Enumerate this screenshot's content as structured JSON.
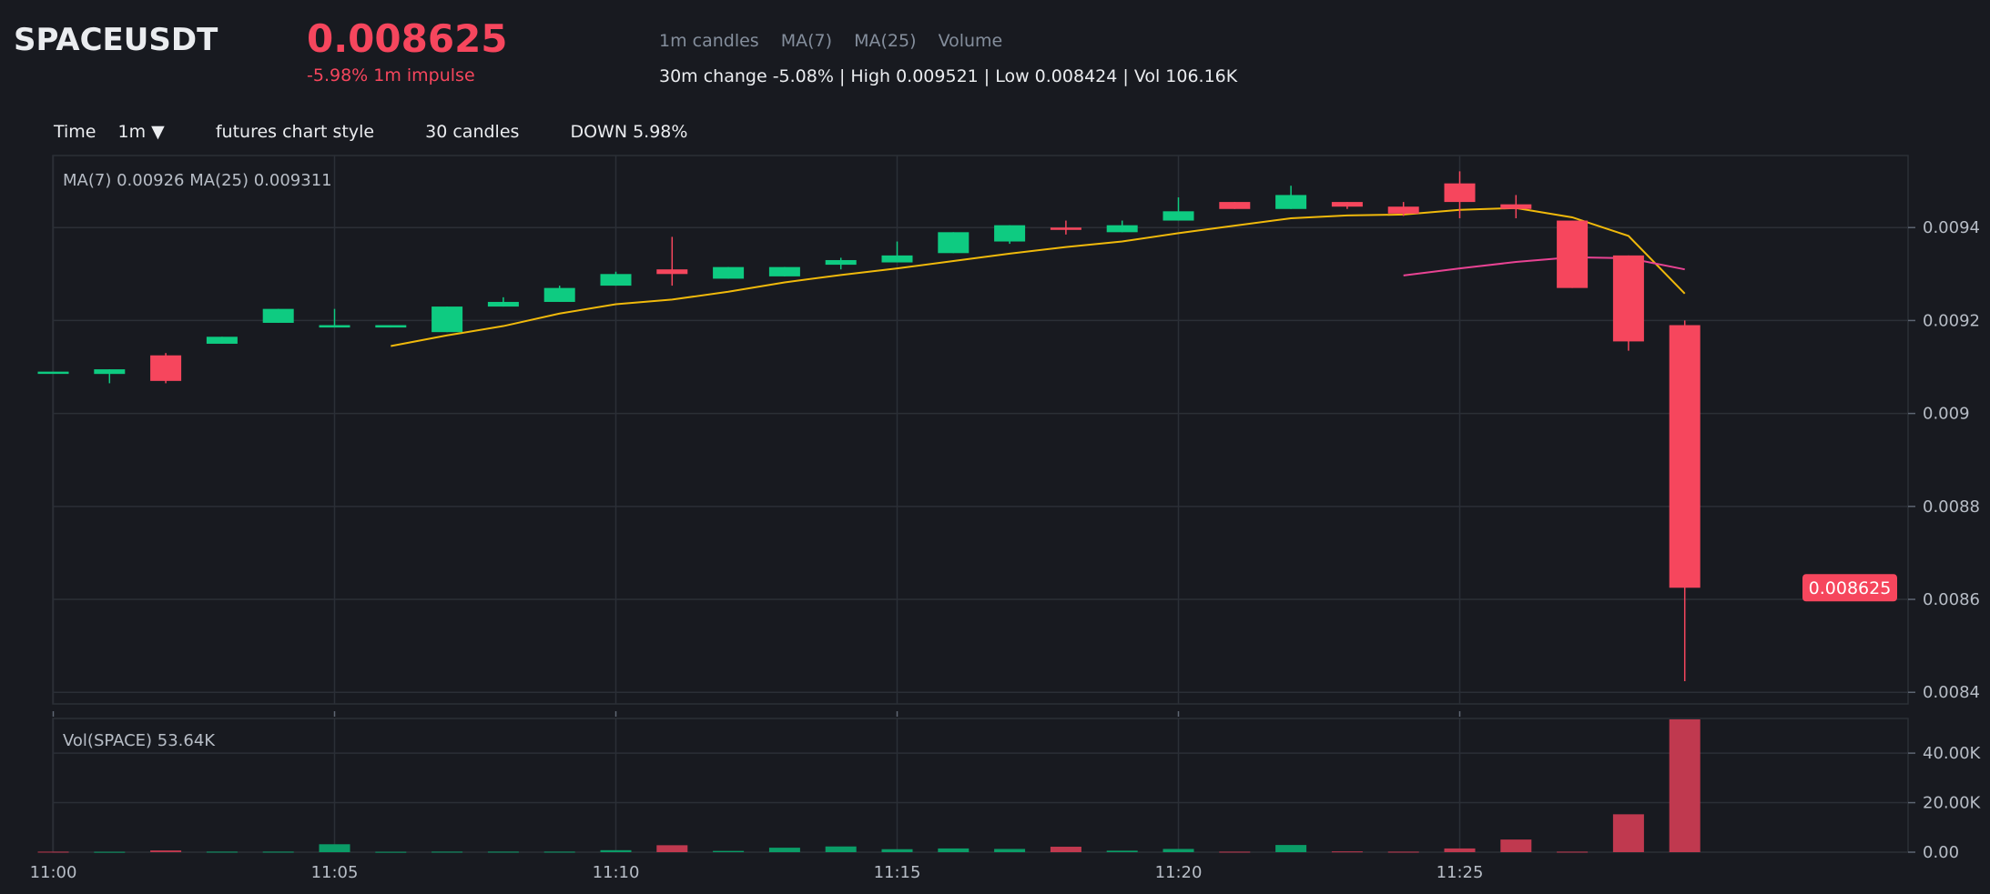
{
  "header": {
    "symbol": "SPACEUSDT",
    "price": "0.008625",
    "impulse": "-5.98% 1m impulse",
    "indicators": [
      "1m candles",
      "MA(7)",
      "MA(25)",
      "Volume"
    ],
    "stats": "30m change -5.08% | High 0.009521 | Low 0.008424 | Vol 106.16K"
  },
  "toolbar": {
    "time_label": "Time",
    "interval": "1m ▼",
    "style": "futures chart style",
    "candles": "30 candles",
    "direction": "DOWN 5.98%"
  },
  "colors": {
    "background": "#181a20",
    "up": "#0ecb81",
    "down": "#f6465d",
    "ma7": "#f0b90b",
    "ma25": "#e84393",
    "volume_down": "#c0394f",
    "volume_up": "#0b9c67",
    "grid": "#2b2f36"
  },
  "chart_data": [
    {
      "type": "candlestick",
      "legend": "MA(7) 0.00926    MA(25) 0.009311",
      "last_price_label": "0.008625",
      "y_ticks": [
        "0.0094",
        "0.0092",
        "0.009",
        "0.0088",
        "0.0086",
        "0.0084"
      ],
      "ylim": [
        0.008375,
        0.009555
      ],
      "x_ticks": [
        "11:00",
        "11:05",
        "11:10",
        "11:15",
        "11:20",
        "11:25"
      ],
      "times": [
        "11:00",
        "11:01",
        "11:02",
        "11:03",
        "11:04",
        "11:05",
        "11:06",
        "11:07",
        "11:08",
        "11:09",
        "11:10",
        "11:11",
        "11:12",
        "11:13",
        "11:14",
        "11:15",
        "11:16",
        "11:17",
        "11:18",
        "11:19",
        "11:20",
        "11:21",
        "11:22",
        "11:23",
        "11:24",
        "11:25",
        "11:26",
        "11:27",
        "11:28",
        "11:29"
      ],
      "candles": [
        {
          "o": 0.00909,
          "h": 0.00909,
          "l": 0.00909,
          "c": 0.00909
        },
        {
          "o": 0.009085,
          "h": 0.009095,
          "l": 0.009065,
          "c": 0.009095
        },
        {
          "o": 0.009125,
          "h": 0.00913,
          "l": 0.009065,
          "c": 0.00907
        },
        {
          "o": 0.00915,
          "h": 0.009165,
          "l": 0.00915,
          "c": 0.009165
        },
        {
          "o": 0.009195,
          "h": 0.009225,
          "l": 0.009195,
          "c": 0.009225
        },
        {
          "o": 0.009185,
          "h": 0.009225,
          "l": 0.009185,
          "c": 0.00919
        },
        {
          "o": 0.009185,
          "h": 0.00919,
          "l": 0.009185,
          "c": 0.00919
        },
        {
          "o": 0.009175,
          "h": 0.00923,
          "l": 0.009175,
          "c": 0.00923
        },
        {
          "o": 0.00923,
          "h": 0.00925,
          "l": 0.00923,
          "c": 0.00924
        },
        {
          "o": 0.00924,
          "h": 0.009275,
          "l": 0.00924,
          "c": 0.00927
        },
        {
          "o": 0.009275,
          "h": 0.009305,
          "l": 0.009275,
          "c": 0.0093
        },
        {
          "o": 0.00931,
          "h": 0.00938,
          "l": 0.009275,
          "c": 0.0093
        },
        {
          "o": 0.00929,
          "h": 0.009315,
          "l": 0.00929,
          "c": 0.009315
        },
        {
          "o": 0.009295,
          "h": 0.009315,
          "l": 0.009295,
          "c": 0.009315
        },
        {
          "o": 0.00932,
          "h": 0.009335,
          "l": 0.00931,
          "c": 0.00933
        },
        {
          "o": 0.009325,
          "h": 0.00937,
          "l": 0.009325,
          "c": 0.00934
        },
        {
          "o": 0.009345,
          "h": 0.00939,
          "l": 0.009345,
          "c": 0.00939
        },
        {
          "o": 0.00937,
          "h": 0.009405,
          "l": 0.009365,
          "c": 0.009405
        },
        {
          "o": 0.0094,
          "h": 0.009415,
          "l": 0.009385,
          "c": 0.009395
        },
        {
          "o": 0.00939,
          "h": 0.009415,
          "l": 0.00939,
          "c": 0.009405
        },
        {
          "o": 0.009415,
          "h": 0.009465,
          "l": 0.009415,
          "c": 0.009435
        },
        {
          "o": 0.009455,
          "h": 0.009455,
          "l": 0.00944,
          "c": 0.00944
        },
        {
          "o": 0.00944,
          "h": 0.00949,
          "l": 0.00944,
          "c": 0.00947
        },
        {
          "o": 0.009455,
          "h": 0.009455,
          "l": 0.00944,
          "c": 0.009445
        },
        {
          "o": 0.009445,
          "h": 0.009455,
          "l": 0.009425,
          "c": 0.00943
        },
        {
          "o": 0.009495,
          "h": 0.009521,
          "l": 0.00942,
          "c": 0.009455
        },
        {
          "o": 0.00945,
          "h": 0.00947,
          "l": 0.00942,
          "c": 0.00944
        },
        {
          "o": 0.009415,
          "h": 0.009415,
          "l": 0.00927,
          "c": 0.00927
        },
        {
          "o": 0.00934,
          "h": 0.00934,
          "l": 0.009135,
          "c": 0.009155
        },
        {
          "o": 0.00919,
          "h": 0.0092,
          "l": 0.008424,
          "c": 0.008625
        }
      ],
      "ma7": [
        null,
        null,
        null,
        null,
        null,
        null,
        0.009145,
        0.009168,
        0.009188,
        0.009215,
        0.009235,
        0.009245,
        0.009262,
        0.009282,
        0.009298,
        0.009312,
        0.009328,
        0.009344,
        0.009358,
        0.00937,
        0.009388,
        0.009404,
        0.00942,
        0.009426,
        0.009428,
        0.009438,
        0.009442,
        0.009422,
        0.009382,
        0.009258
      ],
      "ma25": [
        null,
        null,
        null,
        null,
        null,
        null,
        null,
        null,
        null,
        null,
        null,
        null,
        null,
        null,
        null,
        null,
        null,
        null,
        null,
        null,
        null,
        null,
        null,
        null,
        0.009297,
        0.009312,
        0.009326,
        0.009336,
        0.009334,
        0.00931
      ]
    },
    {
      "type": "bar",
      "legend": "Vol(SPACE) 53.64K",
      "y_ticks": [
        "40.00K",
        "20.00K",
        "0.00"
      ],
      "ylim": [
        0,
        54000
      ],
      "categories": [
        "11:00",
        "11:01",
        "11:02",
        "11:03",
        "11:04",
        "11:05",
        "11:06",
        "11:07",
        "11:08",
        "11:09",
        "11:10",
        "11:11",
        "11:12",
        "11:13",
        "11:14",
        "11:15",
        "11:16",
        "11:17",
        "11:18",
        "11:19",
        "11:20",
        "11:21",
        "11:22",
        "11:23",
        "11:24",
        "11:25",
        "11:26",
        "11:27",
        "11:28",
        "11:29"
      ],
      "values": [
        200,
        150,
        700,
        200,
        200,
        3200,
        150,
        200,
        200,
        200,
        800,
        2800,
        500,
        1800,
        2300,
        1200,
        1500,
        1300,
        2200,
        600,
        1300,
        200,
        2900,
        300,
        200,
        1500,
        5100,
        200,
        15300,
        53640
      ],
      "directions": [
        "down",
        "up",
        "down",
        "up",
        "up",
        "up",
        "up",
        "up",
        "up",
        "up",
        "up",
        "down",
        "up",
        "up",
        "up",
        "up",
        "up",
        "up",
        "down",
        "up",
        "up",
        "down",
        "up",
        "down",
        "down",
        "down",
        "down",
        "down",
        "down",
        "down"
      ]
    }
  ]
}
